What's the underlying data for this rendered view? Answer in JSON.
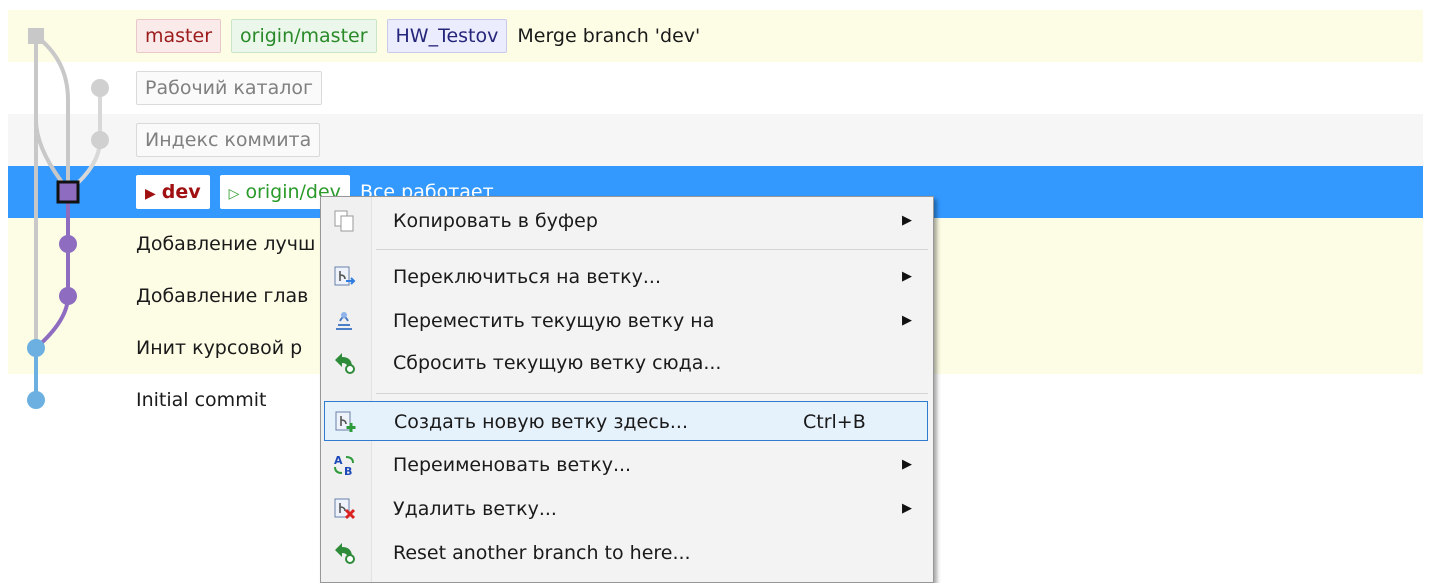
{
  "rows": [
    {
      "refs": {
        "master": "master",
        "origin": "origin/master",
        "tag": "HW_Testov"
      },
      "message": "Merge branch 'dev'"
    },
    {
      "label": "Рабочий каталог"
    },
    {
      "label": "Индекс коммита"
    },
    {
      "refs": {
        "local": "dev",
        "remote": "origin/dev"
      },
      "message": "Все работает"
    },
    {
      "message": "Добавление лучш"
    },
    {
      "message": "Добавление глав"
    },
    {
      "message": "Инит курсовой р"
    },
    {
      "message": "Initial commit"
    }
  ],
  "menu": {
    "items": [
      {
        "label": "Копировать в буфер",
        "icon": "copy-icon",
        "submenu": true
      },
      {
        "label": "Переключиться на ветку...",
        "icon": "checkout-branch-icon",
        "submenu": true
      },
      {
        "label": "Переместить текущую ветку на",
        "icon": "rebase-icon",
        "submenu": true
      },
      {
        "label": "Сбросить текущую ветку сюда...",
        "icon": "reset-icon",
        "submenu": false
      },
      {
        "label": "Создать новую ветку здесь...",
        "icon": "create-branch-icon",
        "shortcut": "Ctrl+B",
        "submenu": false,
        "highlighted": true
      },
      {
        "label": "Переименовать ветку...",
        "icon": "rename-branch-icon",
        "submenu": true
      },
      {
        "label": "Удалить ветку...",
        "icon": "delete-branch-icon",
        "submenu": true
      },
      {
        "label": "Reset another branch to here...",
        "icon": "reset-icon",
        "submenu": false
      }
    ],
    "submenu_arrow": "▶"
  },
  "colors": {
    "selection": "#3399ff",
    "row_highlight": "#fdfde6",
    "graph_gray": "#c8c8c8",
    "graph_purple": "#8e6cc0",
    "graph_blue": "#6bb0e0"
  }
}
